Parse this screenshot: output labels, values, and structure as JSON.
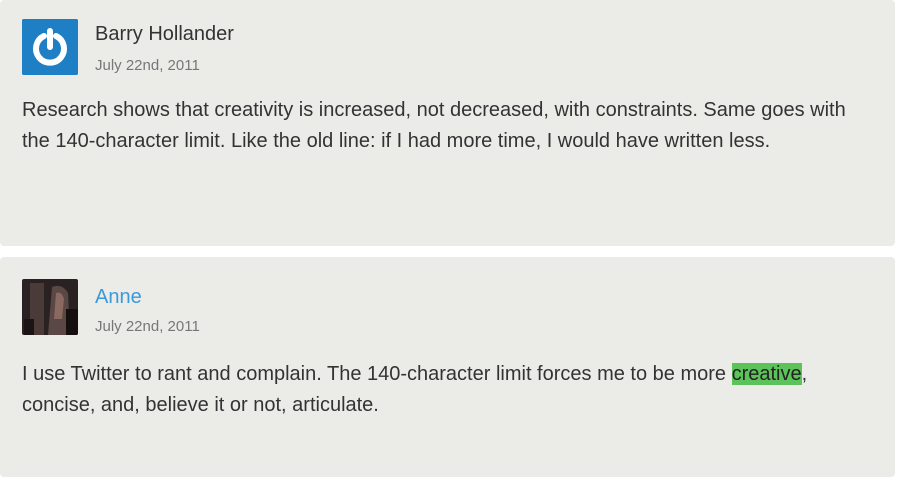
{
  "comments": [
    {
      "author": "Barry Hollander",
      "date": "July 22nd, 2011",
      "avatar_icon": "power-icon",
      "avatar_color": "#1e7fc4",
      "text": "Research shows that creativity is increased, not decreased, with constraints. Same goes with the 140-character limit. Like the old line: if I had more time, I would have written less."
    },
    {
      "author": "Anne",
      "date": "July 22nd, 2011",
      "avatar_icon": "user-photo",
      "author_color": "#3a9ad9",
      "text_before": "I use Twitter to rant and complain. The 140-character limit forces me to be more ",
      "highlighted_word": "creative",
      "text_after": ", concise, and, believe it or not, articulate.",
      "highlight_color": "#5cc35a"
    }
  ]
}
